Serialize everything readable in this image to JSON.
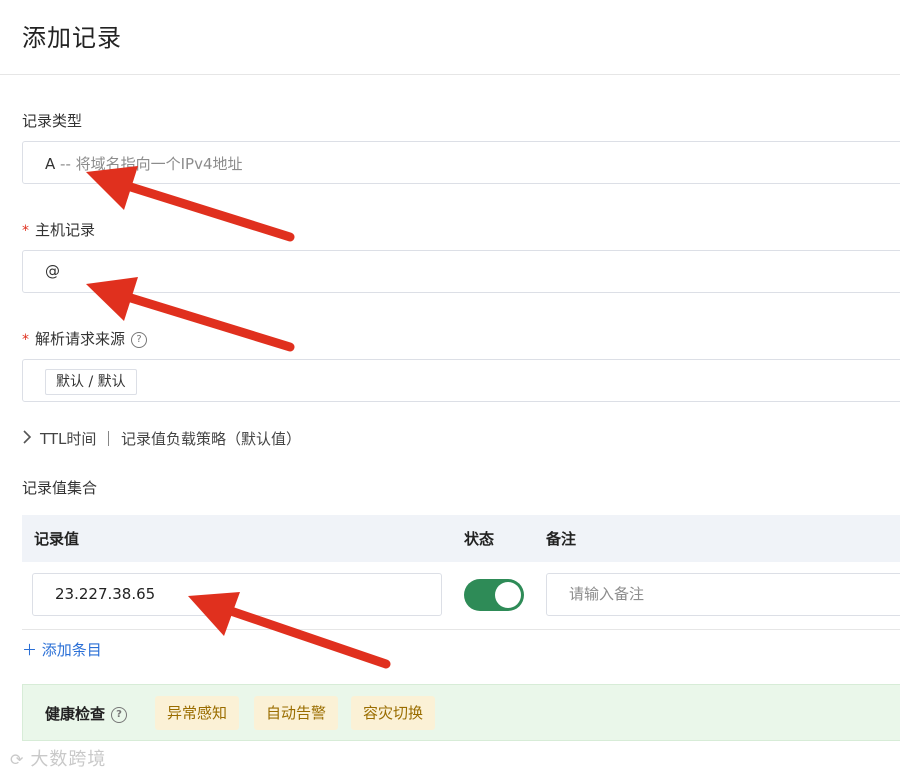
{
  "page_title": "添加记录",
  "record_type": {
    "label": "记录类型",
    "value_code": "A",
    "value_desc": " -- 将域名指向一个IPv4地址"
  },
  "host_record": {
    "label": "主机记录",
    "value": "@"
  },
  "resolve_source": {
    "label": "解析请求来源",
    "tag": "默认 / 默认"
  },
  "advanced_toggle": {
    "chevron": "chevron-right-icon",
    "text": "TTL时间 ｜ 记录值负载策略（默认值）"
  },
  "record_values": {
    "section_label": "记录值集合",
    "headers": {
      "value": "记录值",
      "status": "状态",
      "remark": "备注"
    },
    "rows": [
      {
        "value": "23.227.38.65",
        "status_on": true,
        "remark_placeholder": "请输入备注"
      }
    ],
    "add_item": "＋ 添加条目"
  },
  "health_check": {
    "title": "健康检查",
    "chips": [
      "异常感知",
      "自动告警",
      "容灾切换"
    ]
  },
  "watermark": "大数跨境",
  "colors": {
    "accent_blue": "#2a6fd6",
    "toggle_green": "#2e8b57",
    "arrow_red": "#e0301e",
    "health_bg": "#eaf7ea",
    "chip_bg": "#fbf1d6"
  }
}
